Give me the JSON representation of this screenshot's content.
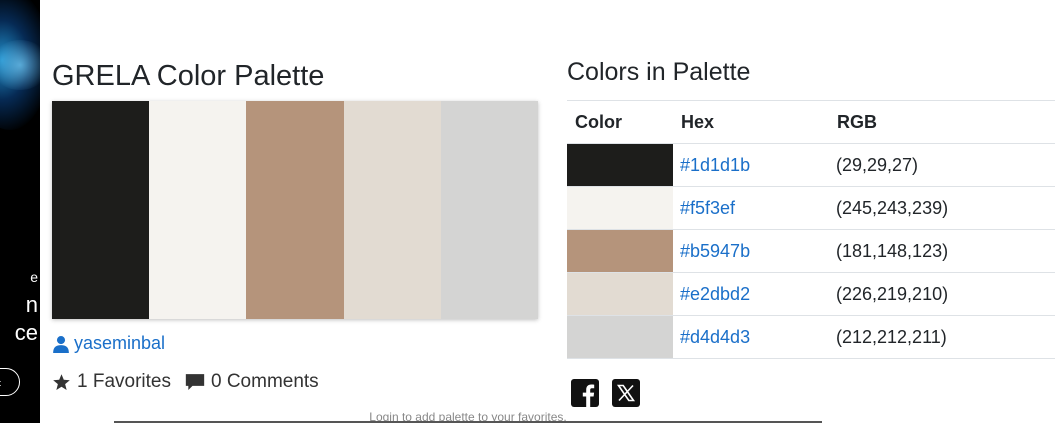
{
  "ad": {
    "text_lines": [
      "e",
      "n",
      "ce"
    ],
    "button_label": "t"
  },
  "palette": {
    "title": "GRELA Color Palette",
    "swatch_colors": [
      "#1d1d1b",
      "#f5f3ef",
      "#b5947b",
      "#e2dbd2",
      "#d4d4d3"
    ],
    "author": "yaseminbal",
    "favorites_label": "1 Favorites",
    "comments_label": "0 Comments",
    "login_note": "Login to add palette to your favorites."
  },
  "colors_table": {
    "title": "Colors in Palette",
    "headers": {
      "color": "Color",
      "hex": "Hex",
      "rgb": "RGB"
    },
    "rows": [
      {
        "color": "#1d1d1b",
        "hex": "#1d1d1b",
        "rgb": "(29,29,27)"
      },
      {
        "color": "#f5f3ef",
        "hex": "#f5f3ef",
        "rgb": "(245,243,239)"
      },
      {
        "color": "#b5947b",
        "hex": "#b5947b",
        "rgb": "(181,148,123)"
      },
      {
        "color": "#e2dbd2",
        "hex": "#e2dbd2",
        "rgb": "(226,219,210)"
      },
      {
        "color": "#d4d4d3",
        "hex": "#d4d4d3",
        "rgb": "(212,212,211)"
      }
    ]
  },
  "social": {
    "icons": [
      "facebook-icon",
      "x-icon"
    ]
  },
  "theme": {
    "link_color": "#1a6fc9",
    "text_color": "#212529"
  }
}
